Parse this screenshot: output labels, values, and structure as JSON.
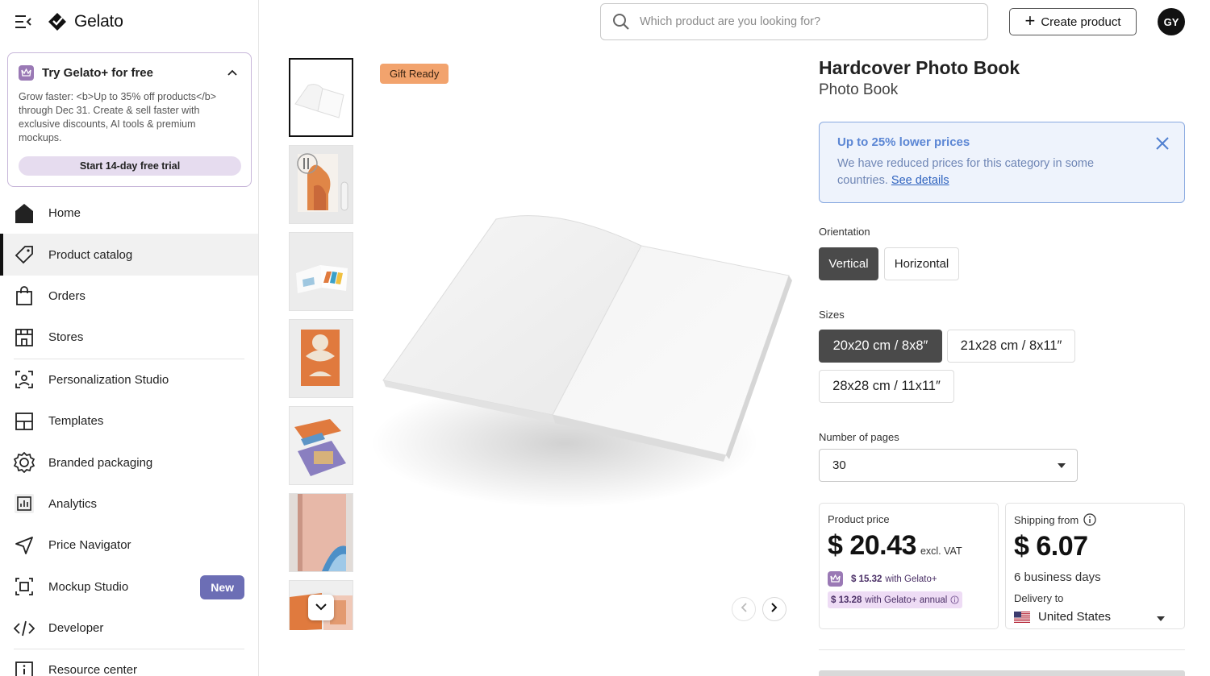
{
  "brand": {
    "name": "Gelato"
  },
  "promo": {
    "title": "Try Gelato+ for free",
    "body": "Grow faster: <b>Up to 35% off products</b> through Dec 31. Create & sell faster with exclusive discounts, AI tools & premium mockups.",
    "cta": "Start 14-day free trial"
  },
  "nav": {
    "home": "Home",
    "catalog": "Product catalog",
    "orders": "Orders",
    "stores": "Stores",
    "personalization": "Personalization Studio",
    "templates": "Templates",
    "packaging": "Branded packaging",
    "analytics": "Analytics",
    "price_navigator": "Price Navigator",
    "mockup": "Mockup Studio",
    "mockup_badge": "New",
    "developer": "Developer",
    "resource": "Resource center"
  },
  "search": {
    "placeholder": "Which product are you looking for?"
  },
  "header": {
    "create_label": "Create product",
    "avatar_initials": "GY"
  },
  "gallery": {
    "badge": "Gift Ready"
  },
  "product": {
    "title": "Hardcover Photo Book",
    "subtitle": "Photo Book"
  },
  "notice": {
    "title": "Up to 25% lower prices",
    "text": "We have reduced prices for this category in some countries.",
    "link": "See details"
  },
  "orientation": {
    "label": "Orientation",
    "options": [
      "Vertical",
      "Horizontal"
    ],
    "selected": "Vertical"
  },
  "sizes": {
    "label": "Sizes",
    "options": [
      "20x20 cm / 8x8″",
      "21x28 cm / 8x11″",
      "28x28 cm / 11x11″"
    ],
    "selected": "20x20 cm / 8x8″"
  },
  "pages": {
    "label": "Number of pages",
    "value": "30"
  },
  "price": {
    "label": "Product price",
    "amount": "$ 20.43",
    "vat": "excl. VAT",
    "plus_price": "$ 15.32",
    "plus_text": "with Gelato+",
    "annual_price": "$ 13.28",
    "annual_text": "with Gelato+ annual"
  },
  "shipping": {
    "label": "Shipping from",
    "amount": "$ 6.07",
    "days": "6 business days",
    "deliver_label": "Delivery to",
    "country": "United States"
  },
  "colors": {
    "accent_purple": "#9a79b5",
    "notice_blue": "#5b86d4",
    "badge_orange": "#f2a36d",
    "new_badge": "#6c6eb5"
  },
  "icons": [
    "menu-collapse-icon",
    "gelato-logo-icon",
    "crown-icon",
    "chevron-up-icon",
    "home-icon",
    "tag-icon",
    "bag-icon",
    "store-icon",
    "face-scan-icon",
    "layout-icon",
    "badge-icon",
    "chart-icon",
    "send-icon",
    "mockup-icon",
    "code-icon",
    "info-square-icon",
    "search-icon",
    "plus-icon",
    "chevron-down-icon",
    "chevron-left-icon",
    "chevron-right-icon",
    "close-icon",
    "info-icon",
    "us-flag-icon"
  ]
}
